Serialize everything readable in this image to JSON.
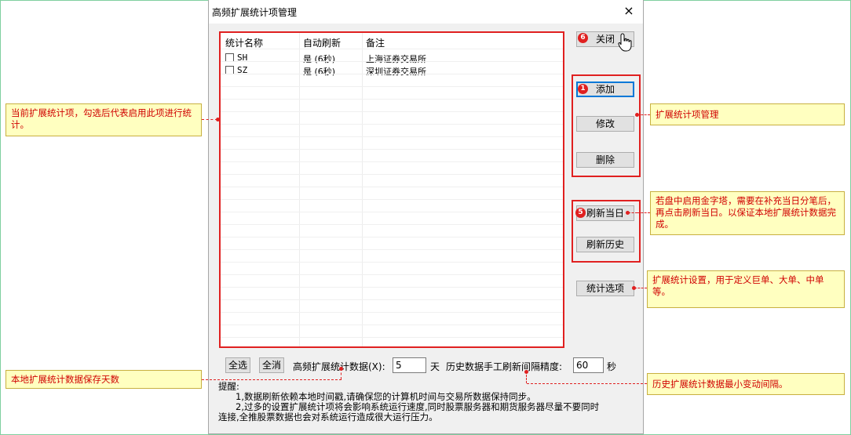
{
  "window": {
    "title": "高频扩展统计项管理",
    "close_glyph": "×"
  },
  "list": {
    "headers": [
      "统计名称",
      "自动刷新",
      "备注"
    ],
    "rows": [
      {
        "name": "SH",
        "auto_refresh": "是 (6秒)",
        "note": "上海证券交易所"
      },
      {
        "name": "SZ",
        "auto_refresh": "是 (6秒)",
        "note": "深圳证券交易所"
      }
    ]
  },
  "buttons": {
    "close": "关闭",
    "add": "添加",
    "modify": "修改",
    "delete": "删除",
    "refresh_today": "刷新当日",
    "refresh_history": "刷新历史",
    "stat_options": "统计选项",
    "select_all": "全选",
    "deselect_all": "全消"
  },
  "badges": {
    "close": "6",
    "add": "1",
    "refresh": "5"
  },
  "bottom": {
    "hf_days_label": "高频扩展统计数据(X):",
    "hf_days_value": "5",
    "days_unit": "天",
    "hist_interval_label": "历史数据手工刷新间隔精度:",
    "hist_interval_value": "60",
    "seconds_unit": "秒"
  },
  "tips": {
    "heading": "提醒:",
    "line1": "1,数据刷新依赖本地时间戳,请确保您的计算机时间与交易所数据保持同步。",
    "line2": "2,过多的设置扩展统计项将会影响系统运行速度,同时股票服务器和期货服务器尽量不要同时",
    "line3": "连接,全推股票数据也会对系统运行造成很大运行压力。"
  },
  "callouts": {
    "left_list": "当前扩展统计项，勾选后代表启用此项进行统计。",
    "left_days": "本地扩展统计数据保存天数",
    "right_manage": "扩展统计项管理",
    "right_refresh": "若盘中启用金字塔，需要在补充当日分笔后，再点击刷新当日。以保证本地扩展统计数据完成。",
    "right_options": "扩展统计设置，用于定义巨单、大单、中单等。",
    "right_interval": "历史扩展统计数据最小变动间隔。"
  },
  "colors": {
    "annotation_red": "#e02020",
    "callout_bg": "#ffffc0",
    "dialog_bg": "#f0f0f0"
  }
}
